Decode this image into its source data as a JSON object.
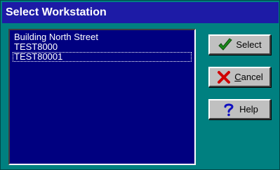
{
  "window": {
    "title": "Select Workstation"
  },
  "workstation_list": {
    "items": [
      {
        "label": "Building North Street",
        "selected": false
      },
      {
        "label": "TEST8000",
        "selected": false
      },
      {
        "label": "TEST80001",
        "selected": true
      }
    ]
  },
  "buttons": {
    "select": {
      "label": "Select",
      "icon": "checkmark-icon"
    },
    "cancel": {
      "accel": "C",
      "rest": "ancel",
      "icon": "red-x-icon"
    },
    "help": {
      "label": "Help",
      "icon": "question-mark-icon"
    }
  },
  "colors": {
    "background": "#008080",
    "titlebar": "#1d1ba6",
    "list_background": "#000080",
    "check_green": "#1a8a1a",
    "cancel_red": "#d00000",
    "help_blue": "#1010c0"
  }
}
